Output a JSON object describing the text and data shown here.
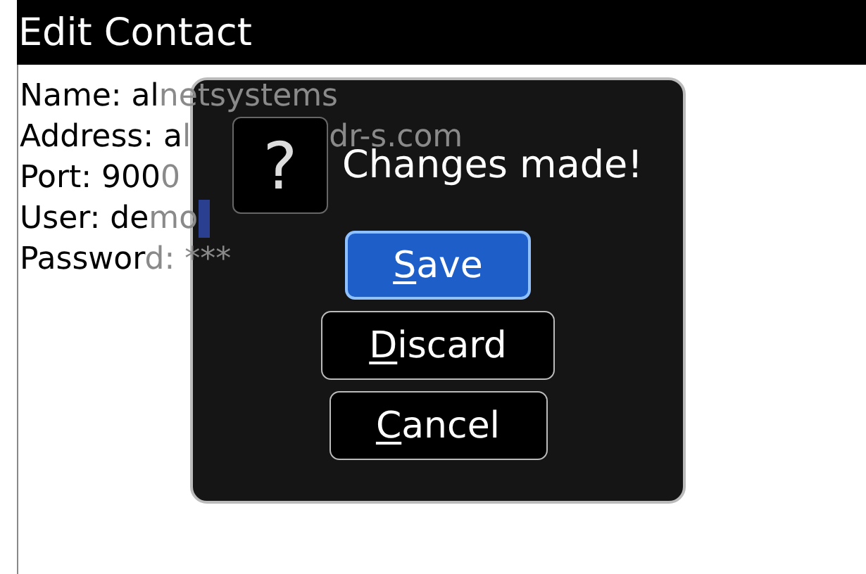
{
  "screen": {
    "title": "Edit Contact"
  },
  "fields": [
    {
      "text": "Name: al",
      "text_dim": "netsystems",
      "cursor": false
    },
    {
      "text": "Address: a",
      "text_dim": "l",
      "text_after_gap": "dr-s.com",
      "cursor": false
    },
    {
      "text": "Port: 900",
      "text_dim": "0",
      "cursor": false
    },
    {
      "text": "User: de",
      "text_dim": "mo",
      "cursor": true
    },
    {
      "text": "Passwor",
      "text_dim": "d: ***",
      "cursor": false
    }
  ],
  "dialog": {
    "icon_glyph": "?",
    "message": "Changes made!",
    "buttons": [
      {
        "label": "Save",
        "selected": true,
        "mnemonic": true
      },
      {
        "label": "Discard",
        "selected": false,
        "mnemonic": true
      },
      {
        "label": "Cancel",
        "selected": false,
        "mnemonic": true
      }
    ]
  }
}
